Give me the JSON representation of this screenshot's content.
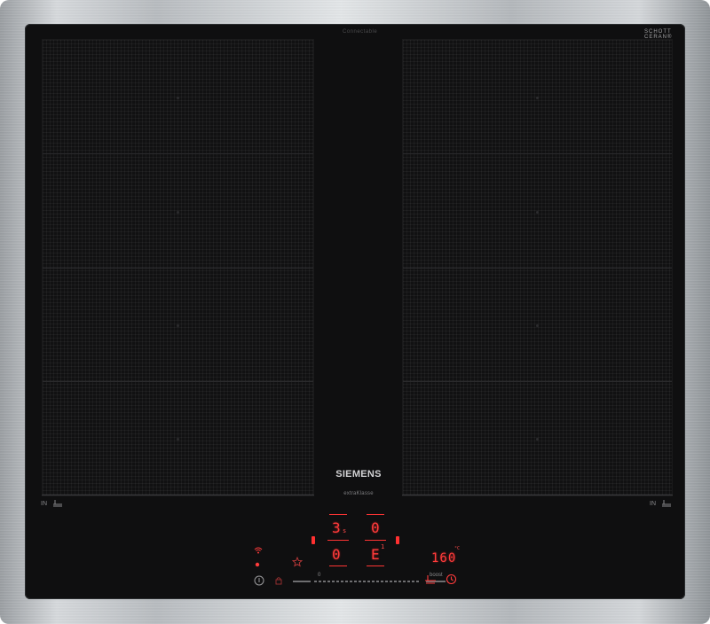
{
  "panel": {
    "connect_label": "Connectable",
    "schott_line1": "SCHOTT",
    "schott_line2": "CERAN®",
    "brand": "SIEMENS",
    "brand_sub": "extraKlasse"
  },
  "zones": {
    "left_label": "IN",
    "right_label": "IN"
  },
  "controls": {
    "top_left_display": "3",
    "top_left_sub": "s",
    "top_right_display": "0",
    "bottom_left_display": "0",
    "bottom_right_display": "E",
    "bottom_right_sub": "1",
    "temperature": "160",
    "temperature_unit": "°C",
    "slider_min": "0",
    "slider_boost": "boost"
  },
  "colors": {
    "display_red": "#ff3b3b",
    "glass": "#0f0f10"
  }
}
